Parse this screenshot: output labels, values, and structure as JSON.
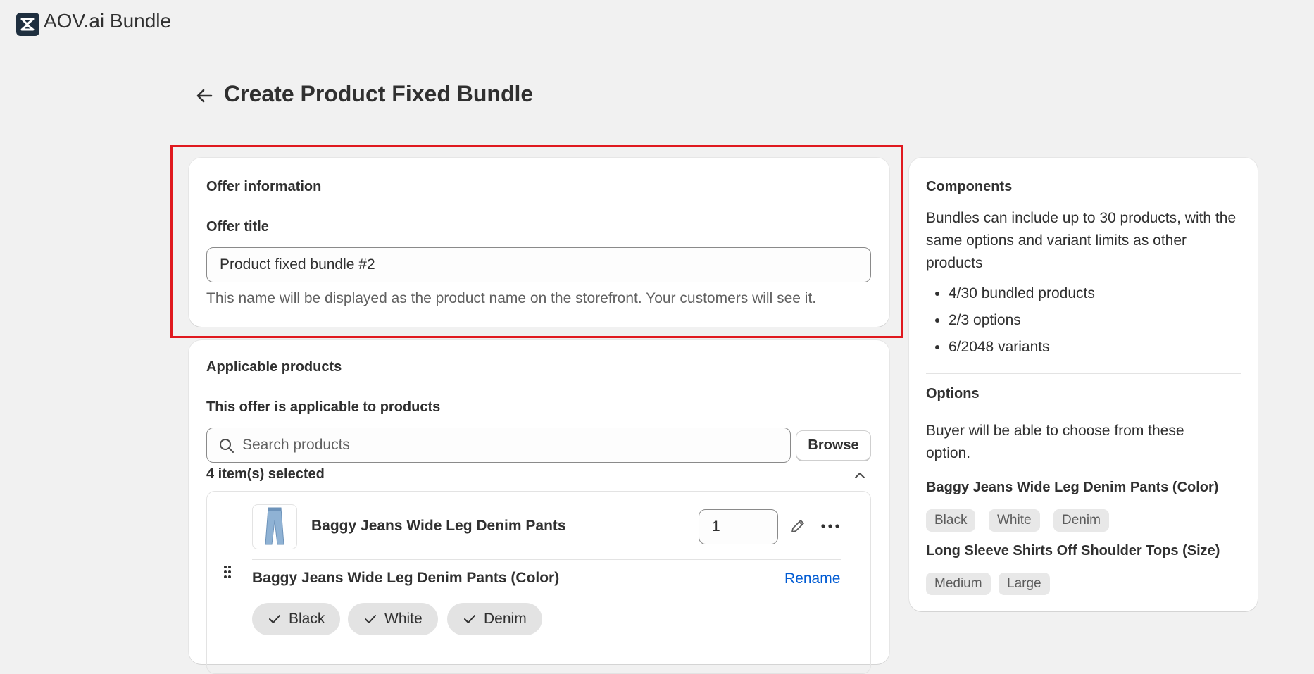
{
  "app": {
    "name": "AOV.ai Bundle"
  },
  "page": {
    "title": "Create Product Fixed Bundle"
  },
  "offer_info": {
    "heading": "Offer information",
    "title_label": "Offer title",
    "title_value": "Product fixed bundle #2",
    "help_text": "This name will be displayed as the product name on the storefront. Your customers will see it."
  },
  "applicable": {
    "heading": "Applicable products",
    "subheading": "This offer is applicable to products",
    "search_placeholder": "Search products",
    "browse_label": "Browse",
    "selected_count": "4 item(s) selected",
    "product": {
      "name": "Baggy Jeans Wide Leg Denim Pants",
      "quantity": "1",
      "option_title": "Baggy Jeans Wide Leg Denim Pants (Color)",
      "rename_label": "Rename",
      "option_values": [
        "Black",
        "White",
        "Denim"
      ]
    }
  },
  "components": {
    "heading": "Components",
    "description": "Bundles can include up to 30 products, with the same options and variant limits as other products",
    "stats": [
      "4/30 bundled products",
      "2/3 options",
      "6/2048 variants"
    ],
    "options_heading": "Options",
    "options_description": "Buyer will be able to choose from these option.",
    "option_groups": [
      {
        "title": "Baggy Jeans Wide Leg Denim Pants (Color)",
        "values": [
          "Black",
          "White",
          "Denim"
        ]
      },
      {
        "title": "Long Sleeve Shirts Off Shoulder Tops (Size)",
        "values": [
          "Medium",
          "Large"
        ]
      }
    ]
  },
  "colors": {
    "accent": "#005bd3",
    "highlight": "#e0191f",
    "background": "#f1f1f1"
  },
  "icons": [
    "app-logo-icon",
    "back-arrow-icon",
    "search-icon",
    "chevron-up-icon",
    "drag-handle-icon",
    "pencil-icon",
    "more-icon",
    "checkmark-icon"
  ]
}
